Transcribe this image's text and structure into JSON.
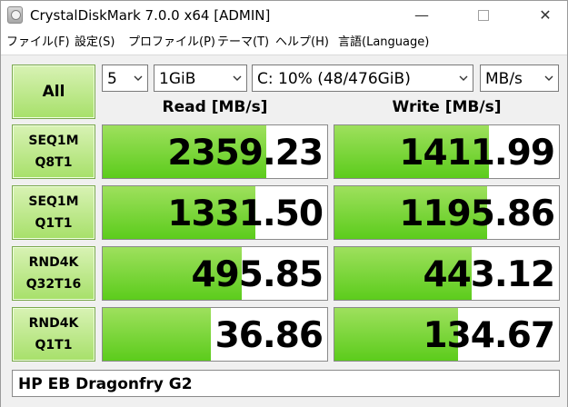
{
  "window": {
    "title": "CrystalDiskMark 7.0.0 x64 [ADMIN]",
    "minimize": "—",
    "close": "✕"
  },
  "menu": [
    "ファイル(F)",
    "設定(S)",
    "プロファイル(P)",
    "テーマ(T)",
    "ヘルプ(H)",
    "言語(Language)"
  ],
  "controls": {
    "all_label": "All",
    "count": "5",
    "size": "1GiB",
    "drive": "C: 10% (48/476GiB)",
    "unit": "MB/s"
  },
  "headers": {
    "read": "Read [MB/s]",
    "write": "Write [MB/s]"
  },
  "rows": [
    {
      "line1": "SEQ1M",
      "line2": "Q8T1",
      "read": "2359.23",
      "write": "1411.99",
      "read_fill": 0.73,
      "write_fill": 0.69
    },
    {
      "line1": "SEQ1M",
      "line2": "Q1T1",
      "read": "1331.50",
      "write": "1195.86",
      "read_fill": 0.68,
      "write_fill": 0.68
    },
    {
      "line1": "RND4K",
      "line2": "Q32T16",
      "read": "495.85",
      "write": "443.12",
      "read_fill": 0.62,
      "write_fill": 0.61
    },
    {
      "line1": "RND4K",
      "line2": "Q1T1",
      "read": "36.86",
      "write": "134.67",
      "read_fill": 0.48,
      "write_fill": 0.55
    }
  ],
  "comment": "HP EB Dragonfry G2",
  "colors": {
    "bar_light": "#9ee05d",
    "bar_dark": "#5ccc1c",
    "button_top": "#d8f2b4",
    "button_bottom": "#a7e06a"
  }
}
